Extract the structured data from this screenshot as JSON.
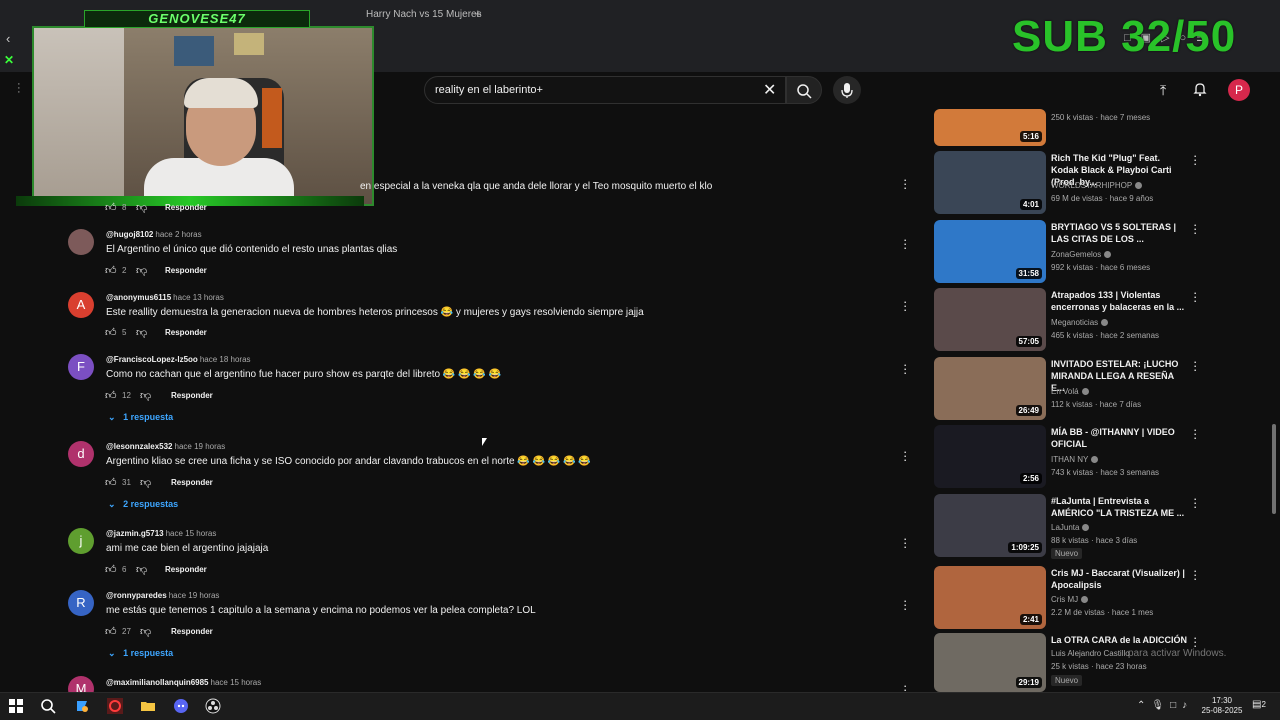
{
  "browser": {
    "tab_title": "Harry Nach vs 15 Mujeres",
    "new_tab": "+"
  },
  "overlay": {
    "streamer_name": "GENOVESE47",
    "sub_goal": "SUB 32/50"
  },
  "search": {
    "query": "reality en el laberinto+"
  },
  "profile": {
    "initial": "P"
  },
  "comments": [
    {
      "text": "en especial a la veneka qla que anda dele llorar y el Teo mosquito muerto el klo",
      "likes": "8",
      "reply_label": "Responder"
    },
    {
      "handle": "@hugoj8102",
      "time": "hace 2 horas",
      "text": "El Argentino el único que dió contenido el resto unas plantas qlias",
      "likes": "2",
      "reply_label": "Responder",
      "avatar_initial": "",
      "avatar_color": "#7d5a5a"
    },
    {
      "handle": "@anonymus6115",
      "time": "hace 13 horas",
      "text": "Este reallity demuestra la generacion nueva de hombres heteros princesos 😂 y mujeres y gays resolviendo siempre jajja",
      "likes": "5",
      "reply_label": "Responder",
      "avatar_initial": "A",
      "avatar_color": "#d93f2f"
    },
    {
      "handle": "@FranciscoLopez-lz5oo",
      "time": "hace 18 horas",
      "text": "Como no cachan que el argentino fue hacer puro show es parqte del libreto 😂 😂 😂 😂",
      "likes": "12",
      "reply_label": "Responder",
      "avatar_initial": "F",
      "avatar_color": "#7b4fc2",
      "replies": "1 respuesta"
    },
    {
      "handle": "@lesonnzalex532",
      "time": "hace 19 horas",
      "text": "Argentino kliao se cree una ficha y se ISO conocido por andar clavando trabucos en el norte 😂 😂 😂 😂 😂",
      "likes": "31",
      "reply_label": "Responder",
      "avatar_initial": "d",
      "avatar_color": "#b0326c",
      "replies": "2 respuestas"
    },
    {
      "handle": "@jazmin.g5713",
      "time": "hace 15 horas",
      "text": "ami me cae bien el argentino jajajaja",
      "likes": "6",
      "reply_label": "Responder",
      "avatar_initial": "j",
      "avatar_color": "#5f9e2f"
    },
    {
      "handle": "@ronnyparedes",
      "time": "hace 19 horas",
      "text": "me estás que tenemos 1 capitulo a la semana y encima no podemos ver la pelea completa? LOL",
      "likes": "27",
      "reply_label": "Responder",
      "avatar_initial": "R",
      "avatar_color": "#3664c4",
      "replies": "1 respuesta"
    },
    {
      "handle": "@maximilianollanquin6985",
      "time": "hace 15 horas",
      "avatar_initial": "M",
      "avatar_color": "#b0326c"
    }
  ],
  "videos": [
    {
      "duration": "5:16",
      "views": "250 k vistas · hace 7 meses",
      "thumb": "#d27a3a"
    },
    {
      "title": "Rich The Kid \"Plug\" Feat. Kodak Black & Playboi Carti (Prod. by...",
      "channel": "WORLDSTARHIPHOP",
      "views": "69 M de vistas · hace 9 años",
      "duration": "4:01",
      "thumb": "#3a4656"
    },
    {
      "title": "BRYTIAGO VS 5 SOLTERAS | LAS CITAS DE LOS ...",
      "channel": "ZonaGemelos",
      "views": "992 k vistas · hace 6 meses",
      "duration": "31:58",
      "thumb": "#2f78c8"
    },
    {
      "title": "Atrapados 133 | Violentas encerronas y balaceras en la ...",
      "channel": "Meganoticias",
      "views": "465 k vistas · hace 2 semanas",
      "duration": "57:05",
      "thumb": "#5a4a4a"
    },
    {
      "title": "INVITADO ESTELAR: ¡LUCHO MIRANDA LLEGA A RESEÑA E...",
      "channel": "En Volá",
      "views": "112 k vistas · hace 7 días",
      "duration": "26:49",
      "thumb": "#8a6d58"
    },
    {
      "title": "MÍA BB - @ITHANNY | VIDEO OFICIAL",
      "channel": "ITHAN NY",
      "views": "743 k vistas · hace 3 semanas",
      "duration": "2:56",
      "thumb": "#1a1a22"
    },
    {
      "title": "#LaJunta | Entrevista a AMÉRICO \"LA TRISTEZA ME ...",
      "channel": "LaJunta",
      "views": "88 k vistas · hace 3 días",
      "duration": "1:09:25",
      "badge": "Nuevo",
      "thumb": "#3c3c46"
    },
    {
      "title": "Cris MJ - Baccarat (Visualizer) | Apocalipsis",
      "channel": "Cris MJ",
      "views": "2.2 M de vistas · hace 1 mes",
      "duration": "2:41",
      "thumb": "#b0653e"
    },
    {
      "title": "La OTRA CARA de la ADICCIÓN",
      "channel": "Luis Alejandro Castillo",
      "views": "25 k vistas · hace 23 horas",
      "duration": "29:19",
      "badge": "Nuevo",
      "thumb": "#6f6a62"
    }
  ],
  "windows_watermark": "para activar Windows.",
  "clock": {
    "time": "17:30",
    "date": "25-08-2025"
  },
  "notifications": "2"
}
